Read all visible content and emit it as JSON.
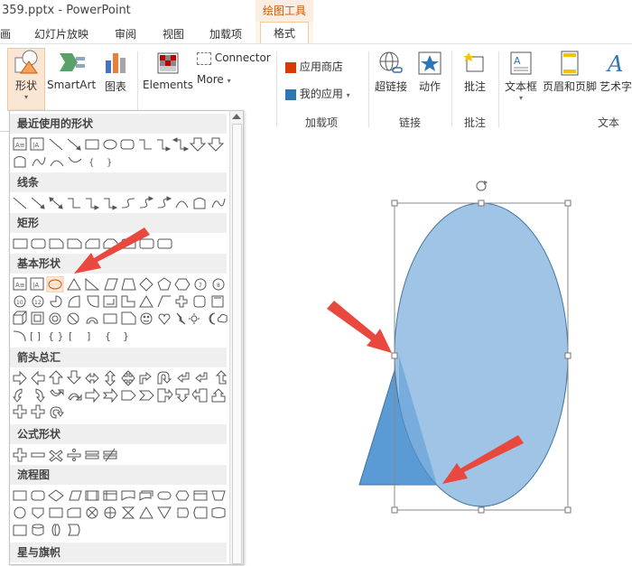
{
  "window": {
    "doc_title": "359.pptx - PowerPoint",
    "context_label": "绘图工具"
  },
  "tabs": [
    {
      "label": "画",
      "active": false
    },
    {
      "label": "幻灯片放映",
      "active": false
    },
    {
      "label": "审阅",
      "active": false
    },
    {
      "label": "视图",
      "active": false
    },
    {
      "label": "加载项",
      "active": false
    },
    {
      "label": "格式",
      "active": true
    }
  ],
  "ribbon": {
    "shapes": "形状",
    "smartart": "SmartArt",
    "chart": "图表",
    "elements": "Elements",
    "connector": "Connector",
    "more": "More",
    "app_store": "应用商店",
    "my_apps": "我的应用",
    "addins_group": "加载项",
    "hyperlink": "超链接",
    "action": "动作",
    "links_group": "链接",
    "comment": "批注",
    "comment_group": "批注",
    "textbox": "文本框",
    "header_footer": "页眉和页脚",
    "wordart": "艺术字",
    "text_group": "文本"
  },
  "gallery": {
    "sections": [
      "最近使用的形状",
      "线条",
      "矩形",
      "基本形状",
      "箭头总汇",
      "公式形状",
      "流程图",
      "星与旗帜"
    ]
  },
  "colors": {
    "accent": "#c55a11",
    "ellipse_fill": "#9dc3e6",
    "triangle_fill": "#5b9bd5",
    "arrow": "#e8483e"
  }
}
